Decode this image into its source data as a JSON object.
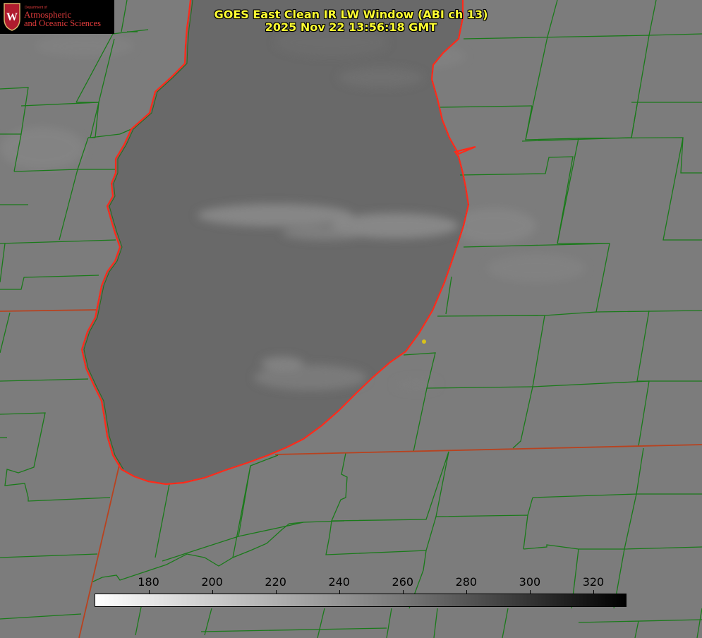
{
  "logo": {
    "department": "Department of",
    "line1": "Atmospheric",
    "line2": "and Oceanic Sciences",
    "crest_letter": "W",
    "brand_color": "#e23c3c"
  },
  "title": {
    "line1": "GOES East Clean IR LW Window (ABI ch 13)",
    "line2": "2025 Nov 22 13:56:18 GMT",
    "color": "#ffff33"
  },
  "colorbar": {
    "ticks": [
      "180",
      "200",
      "220",
      "240",
      "260",
      "280",
      "300",
      "320"
    ],
    "tick_values": [
      180,
      200,
      220,
      240,
      260,
      280,
      300,
      320
    ],
    "range": [
      163,
      330
    ],
    "colormap": "grayscale (white cold → black warm)"
  },
  "map": {
    "lake_color": "#696969",
    "land_color": "#7c7c7c",
    "county_line_color": "#1a7a1a",
    "state_line_color": "#c03a20",
    "shoreline_color": "#ff2a1a",
    "marker_color": "#d8c21a"
  }
}
